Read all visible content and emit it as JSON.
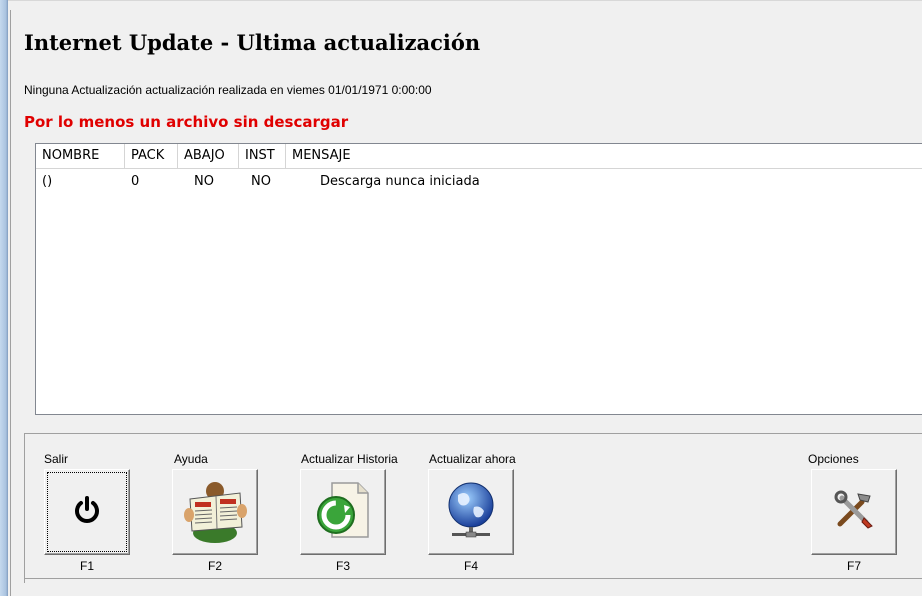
{
  "header": {
    "title": "Internet Update - Ultima actualización",
    "subtitle": "Ninguna Actualización actualización realizada en  viemes 01/01/1971 0:00:00",
    "warning": "Por lo menos un archivo sin descargar"
  },
  "table": {
    "columns": [
      "NOMBRE",
      "PACK",
      "ABAJO",
      "INST",
      "MENSAJE"
    ],
    "rows": [
      {
        "nombre": "()",
        "pack": "0",
        "abajo": "NO",
        "inst": "NO",
        "mensaje": "Descarga nunca iniciada"
      }
    ]
  },
  "toolbar": {
    "buttons": [
      {
        "label": "Salir",
        "key": "F1",
        "icon": "power-icon"
      },
      {
        "label": "Ayuda",
        "key": "F2",
        "icon": "newspaper-reader-icon"
      },
      {
        "label": "Actualizar Historia",
        "key": "F3",
        "icon": "refresh-document-icon"
      },
      {
        "label": "Actualizar ahora",
        "key": "F4",
        "icon": "globe-network-icon"
      },
      {
        "label": "Opciones",
        "key": "F7",
        "icon": "tools-icon"
      }
    ]
  },
  "colors": {
    "warning": "#e00000",
    "background": "#f0f0f0"
  }
}
